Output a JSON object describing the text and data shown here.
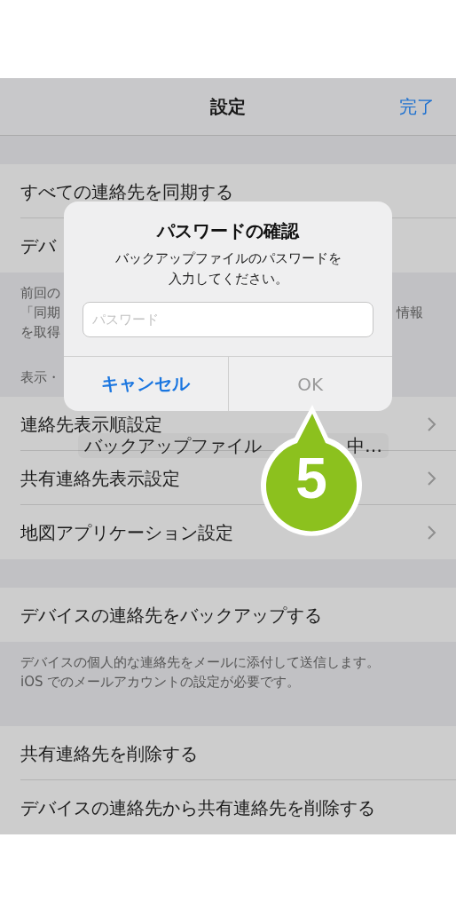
{
  "nav": {
    "title": "設定",
    "done": "完了"
  },
  "groups": [
    {
      "rows": [
        {
          "label": "すべての連絡先を同期する",
          "chevron": false
        },
        {
          "label": "デバ",
          "chevron": false
        }
      ],
      "footer": [
        {
          "left": "前回の"
        },
        {
          "left": "「同期",
          "right": "情報"
        },
        {
          "left": "を取得"
        }
      ]
    },
    {
      "header": "表示・",
      "rows": [
        {
          "label": "連絡先表示順設定",
          "chevron": true
        },
        {
          "label": "共有連絡先表示設定",
          "chevron": true
        },
        {
          "label": "地図アプリケーション設定",
          "chevron": true
        }
      ]
    },
    {
      "rows": [
        {
          "label": "デバイスの連絡先をバックアップする",
          "chevron": false
        }
      ],
      "footer": [
        {
          "left": "デバイスの個人的な連絡先をメールに添付して送信します。"
        },
        {
          "left": "iOS でのメールアカウントの設定が必要です。"
        }
      ]
    },
    {
      "rows": [
        {
          "label": "共有連絡先を削除する",
          "chevron": false
        },
        {
          "label": "デバイスの連絡先から共有連絡先を削除する",
          "chevron": false
        }
      ]
    }
  ],
  "hud": {
    "parts": [
      "バックアップファイル",
      "中…"
    ]
  },
  "dialog": {
    "title": "パスワードの確認",
    "message": [
      "バックアップファイルのパスワードを",
      "入力してください。"
    ],
    "field": {
      "placeholder": "パスワード"
    },
    "buttons": [
      {
        "label": "キャンセル",
        "kind": "cancel",
        "disabled": false
      },
      {
        "label": "OK",
        "kind": "default",
        "disabled": true
      }
    ]
  },
  "callout": {
    "number": "5"
  }
}
